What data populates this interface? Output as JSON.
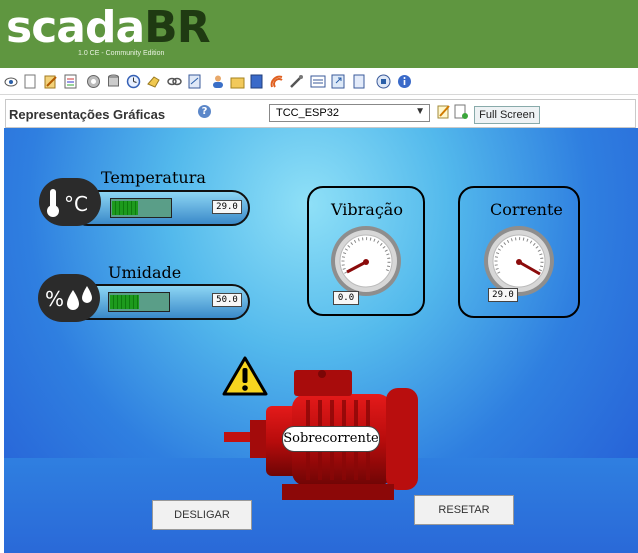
{
  "header": {
    "logo_main": "scada",
    "logo_accent": "BR",
    "logo_sub": "1.0 CE - Community Edition"
  },
  "toolbar": {
    "icons": [
      "eye-icon",
      "page-icon",
      "edit-icon",
      "list-icon",
      "gear-icon",
      "cylinder-icon",
      "clock-icon",
      "hand-icon",
      "link-icon",
      "report-icon",
      "users-icon",
      "folder-icon",
      "book-icon",
      "signal-icon",
      "tools-icon",
      "data-icon",
      "export-icon",
      "doc-icon",
      "stop-icon",
      "info-icon"
    ]
  },
  "view": {
    "title": "Representações Gráficas",
    "selected_view": "TCC_ESP32",
    "full_screen_label": "Full Screen"
  },
  "graphics": {
    "temperature": {
      "label": "Temperatura",
      "value": "29.0",
      "level": 0.45
    },
    "humidity": {
      "label": "Umidade",
      "value": "50.0",
      "level": 0.5
    },
    "vibration": {
      "label": "Vibração",
      "value": "0.0"
    },
    "current": {
      "label": "Corrente",
      "value": "29.0"
    },
    "motor_status": "Sobrecorrente",
    "stop_button": "DESLIGAR",
    "reset_button": "RESETAR"
  }
}
